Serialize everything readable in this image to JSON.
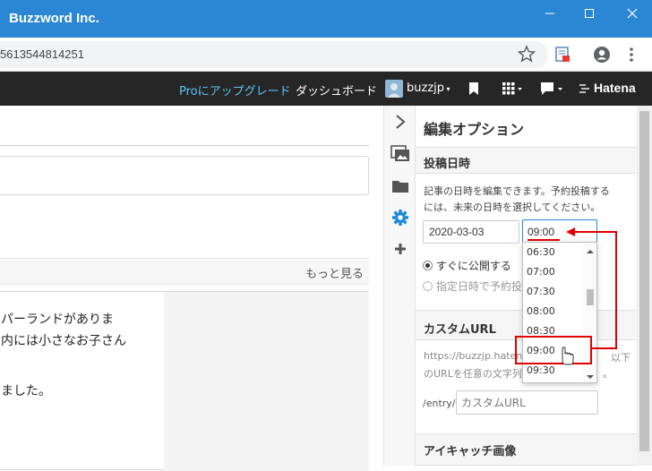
{
  "window": {
    "title": "Buzzword Inc."
  },
  "address": {
    "url": "5613544814251"
  },
  "hatena": {
    "pro_link": "Proにアップグレード",
    "dashboard": "ダッシュボード",
    "username": "buzzjp",
    "logo": "Hatena"
  },
  "main": {
    "more_link": "もっと見る",
    "body_lines": [
      "パーランドがありま",
      "内には小さなお子さん",
      "ました。"
    ]
  },
  "panel": {
    "title": "編集オプション",
    "post_date": {
      "heading": "投稿日時",
      "description_line1": "記事の日時を編集できます。予約投稿する",
      "description_line2": "には、未来の日時を選択してください。",
      "date_value": "2020-03-03",
      "time_value": "09:00",
      "radio_now": "すぐに公開する",
      "radio_scheduled": "指定日時で予約投"
    },
    "custom_url": {
      "heading": "カスタムURL",
      "desc_line1_start": "https://buzzjp.hatena",
      "desc_line1_end": "以下",
      "desc_line2_start": "のURLを任意の文字列",
      "desc_line2_end": "。",
      "prefix": "/entry/",
      "placeholder": "カスタムURL"
    },
    "eyecatch": {
      "heading": "アイキャッチ画像"
    }
  },
  "time_dropdown": {
    "options": [
      "06:30",
      "07:00",
      "07:30",
      "08:00",
      "08:30",
      "09:00",
      "09:30"
    ],
    "selected": "09:00"
  },
  "colors": {
    "titlebar": "#2b87d3",
    "hatena_bar": "#262626",
    "pro_link": "#5cc6f5",
    "accent_blue": "#1f8ad7",
    "annotation_red": "#e00000"
  }
}
